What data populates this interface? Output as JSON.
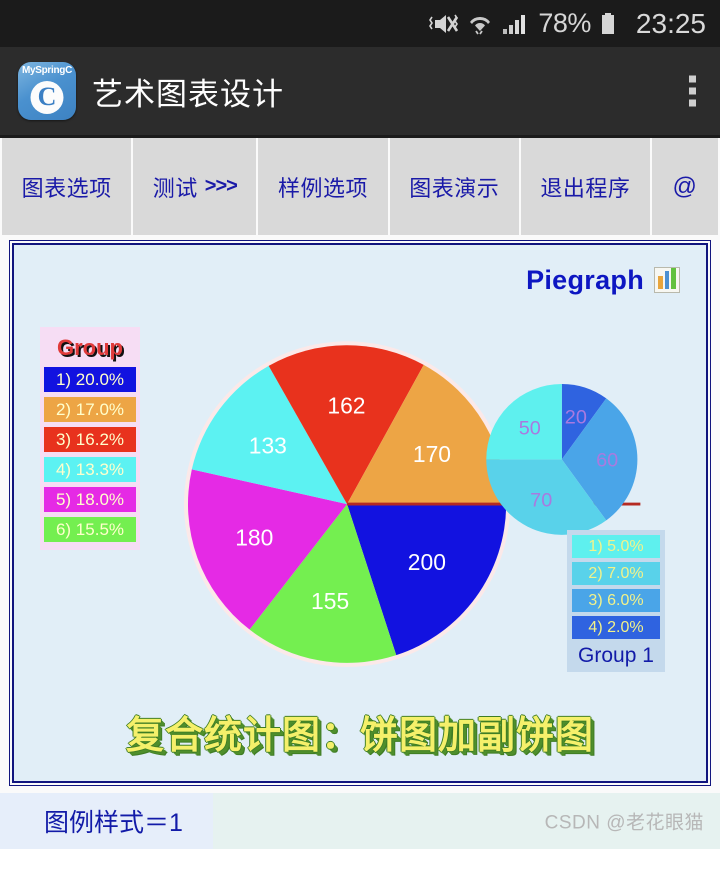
{
  "statusbar": {
    "battery_percent": "78%",
    "time": "23:25",
    "icons": [
      "mute-vibrate-icon",
      "wifi-icon",
      "signal-icon",
      "battery-icon"
    ]
  },
  "appbar": {
    "icon_label": "MySpringC",
    "icon_letter": "C",
    "title": "艺术图表设计",
    "overflow_icon": "overflow-menu-icon"
  },
  "tabs": [
    {
      "label": "图表选项",
      "name": "tab-chart-options"
    },
    {
      "label": "测试",
      "suffix": ">>>",
      "name": "tab-test"
    },
    {
      "label": "样例选项",
      "name": "tab-sample-options"
    },
    {
      "label": "图表演示",
      "name": "tab-chart-demo"
    },
    {
      "label": "退出程序",
      "name": "tab-exit"
    },
    {
      "label": "@",
      "name": "tab-at"
    }
  ],
  "chart": {
    "header_title": "Piegraph",
    "header_icon": "bar-chart-icon",
    "caption": "复合统计图：饼图加副饼图",
    "panel_bg": "#e1eef7",
    "panel_border": "#11157e",
    "connector_color": "#b52a22"
  },
  "legend_main": {
    "title": "Group",
    "title_color": "#e03a3a",
    "bg": "#f6ddf4",
    "rows": [
      {
        "label": "1)  20.0%",
        "color": "#1212e0"
      },
      {
        "label": "2)  17.0%",
        "color": "#eda545"
      },
      {
        "label": "3)  16.2%",
        "color": "#e8321d"
      },
      {
        "label": "4)  13.3%",
        "color": "#5cf2f2"
      },
      {
        "label": "5)  18.0%",
        "color": "#e52ae5"
      },
      {
        "label": "6)  15.5%",
        "color": "#74ef50"
      }
    ]
  },
  "legend_sub": {
    "footer": "Group 1",
    "bg": "#c4d9ec",
    "rows": [
      {
        "label": "1)  5.0%",
        "color": "#5ef0ee"
      },
      {
        "label": "2)  7.0%",
        "color": "#59d2ea"
      },
      {
        "label": "3)  6.0%",
        "color": "#4aa5e8"
      },
      {
        "label": "4)  2.0%",
        "color": "#2f63e0"
      }
    ]
  },
  "footer": {
    "status": "图例样式＝1",
    "watermark": "CSDN @老花眼猫"
  },
  "chart_data": [
    {
      "type": "pie",
      "title": "Piegraph",
      "name": "main-pie",
      "legend_position": "left",
      "center": [
        345,
        260
      ],
      "radius": 162,
      "start_angle_deg": 0,
      "direction": "clockwise",
      "labels": [
        "1)",
        "2)",
        "3)",
        "4)",
        "5)",
        "6)"
      ],
      "values": [
        200,
        170,
        162,
        133,
        180,
        155
      ],
      "percents": [
        20.0,
        17.0,
        16.2,
        13.3,
        18.0,
        15.5
      ],
      "colors": [
        "#1212e0",
        "#eda545",
        "#e8321d",
        "#5cf2f2",
        "#e52ae5",
        "#74ef50"
      ],
      "slice_order_clockwise_from_3oclock": [
        {
          "value": 200,
          "color": "#1212e0"
        },
        {
          "value": 155,
          "color": "#74ef50"
        },
        {
          "value": 180,
          "color": "#e52ae5"
        },
        {
          "value": 133,
          "color": "#5cf2f2"
        },
        {
          "value": 162,
          "color": "#e8321d"
        },
        {
          "value": 170,
          "color": "#eda545"
        }
      ]
    },
    {
      "type": "pie",
      "title": "Group 1",
      "name": "sub-pie",
      "legend_position": "below",
      "center": [
        562,
        442
      ],
      "radius": 78,
      "start_angle_deg": -90,
      "direction": "clockwise",
      "labels": [
        "1)",
        "2)",
        "3)",
        "4)"
      ],
      "values": [
        50,
        70,
        60,
        20
      ],
      "percents": [
        5.0,
        7.0,
        6.0,
        2.0
      ],
      "colors": [
        "#5ef0ee",
        "#59d2ea",
        "#4aa5e8",
        "#2f63e0"
      ],
      "slice_order_clockwise_from_12oclock": [
        {
          "value": 20,
          "color": "#2f63e0"
        },
        {
          "value": 60,
          "color": "#4aa5e8"
        },
        {
          "value": 70,
          "color": "#59d2ea"
        },
        {
          "value": 50,
          "color": "#5ef0ee"
        }
      ]
    }
  ]
}
